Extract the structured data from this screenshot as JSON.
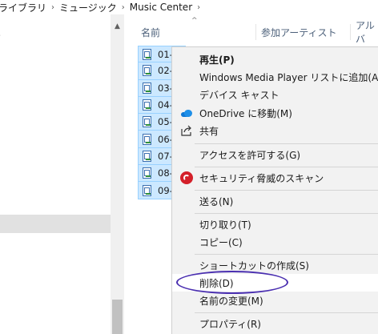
{
  "breadcrumb": {
    "items": [
      "ライブラリ",
      "ミュージック",
      "Music Center"
    ],
    "separator": "›"
  },
  "columns": {
    "name": "名前",
    "artist": "参加アーティスト",
    "album": "アルバ"
  },
  "files": [
    {
      "label": "01-"
    },
    {
      "label": "02-"
    },
    {
      "label": "03-"
    },
    {
      "label": "04-"
    },
    {
      "label": "05-"
    },
    {
      "label": "06-"
    },
    {
      "label": "07-"
    },
    {
      "label": "08-"
    },
    {
      "label": "09-"
    }
  ],
  "context_menu": {
    "play": "再生(P)",
    "add_to_wmp": "Windows Media Player リストに追加(A)",
    "cast": "デバイス キャスト",
    "move_onedrive": "OneDrive に移動(M)",
    "share": "共有",
    "give_access": "アクセスを許可する(G)",
    "security_scan": "セキュリティ脅威のスキャン",
    "send_to": "送る(N)",
    "cut": "切り取り(T)",
    "copy": "コピー(C)",
    "create_shortcut": "ショートカットの作成(S)",
    "delete": "削除(D)",
    "rename": "名前の変更(M)",
    "properties": "プロパティ(R)"
  },
  "colors": {
    "selection_fill": "#cce8ff",
    "selection_border": "#99d1ff",
    "menu_background": "#f2f2f2",
    "annotation": "#4a2fb0",
    "onedrive": "#0f78d4",
    "security": "#d4202a"
  },
  "icons": {
    "onedrive": "onedrive-cloud-icon",
    "share": "share-icon",
    "security": "security-scan-icon",
    "file": "audio-file-icon"
  }
}
